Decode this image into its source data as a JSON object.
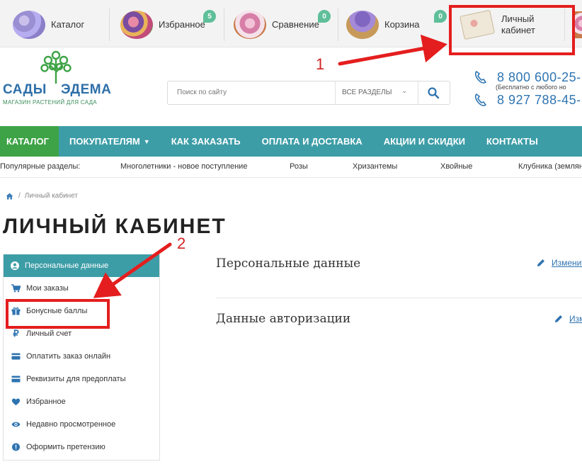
{
  "top_bar": {
    "items": [
      {
        "label": "Каталог",
        "icon": "catalog-flower-icon"
      },
      {
        "label": "Избранное",
        "icon": "favorites-flower-icon",
        "badge": "5"
      },
      {
        "label": "Сравнение",
        "icon": "compare-flower-icon",
        "badge": "0"
      },
      {
        "label": "Корзина",
        "icon": "cart-basket-icon",
        "badge": "0"
      },
      {
        "label_line1": "Личный",
        "label_line2": "кабинет",
        "icon": "account-card-icon"
      }
    ]
  },
  "logo": {
    "brand_left": "САДЫ",
    "brand_right": "ЭДЕМА",
    "tagline": "МАГАЗИН РАСТЕНИЙ ДЛЯ САДА"
  },
  "search": {
    "placeholder": "Поиск по сайту",
    "section_select": "ВСЕ РАЗДЕЛЫ"
  },
  "phones": {
    "phone1": "8 800 600-25-",
    "phone1_note": "(Бесплатно с любого но",
    "phone2": "8 927 788-45-"
  },
  "nav": {
    "items": [
      "КАТАЛОГ",
      "ПОКУПАТЕЛЯМ",
      "КАК ЗАКАЗАТЬ",
      "ОПЛАТА И ДОСТАВКА",
      "АКЦИИ И СКИДКИ",
      "КОНТАКТЫ"
    ]
  },
  "popular": {
    "label": "Популярные разделы:",
    "links": [
      "Многолетники - новое поступление",
      "Розы",
      "Хризантемы",
      "Хвойные",
      "Клубника (землян"
    ]
  },
  "breadcrumb": {
    "current": "Личный кабинет"
  },
  "page_title": "ЛИЧНЫЙ КАБИНЕТ",
  "sidebar": {
    "header": "Персональные данные",
    "items": [
      {
        "label": "Мои заказы",
        "icon": "cart-icon"
      },
      {
        "label": "Бонусные баллы",
        "icon": "gift-icon"
      },
      {
        "label": "Личный счет",
        "icon": "ruble-icon"
      },
      {
        "label": "Оплатить заказ онлайн",
        "icon": "credit-card-icon"
      },
      {
        "label": "Реквизиты для предоплаты",
        "icon": "credit-card-icon"
      },
      {
        "label": "Избранное",
        "icon": "heart-icon"
      },
      {
        "label": "Недавно просмотренное",
        "icon": "eye-icon"
      },
      {
        "label": "Оформить претензию",
        "icon": "exclamation-circle-icon"
      }
    ]
  },
  "content": {
    "section1_title": "Персональные данные",
    "section1_edit": "Изменит",
    "section2_title": "Данные авторизации",
    "section2_edit": "Изм"
  },
  "annotations": {
    "marker1": "1",
    "marker2": "2",
    "color": "#e41e1e"
  },
  "colors": {
    "nav_teal": "#3d9da7",
    "catalog_green": "#3ea346",
    "link_blue": "#2e73b0"
  }
}
